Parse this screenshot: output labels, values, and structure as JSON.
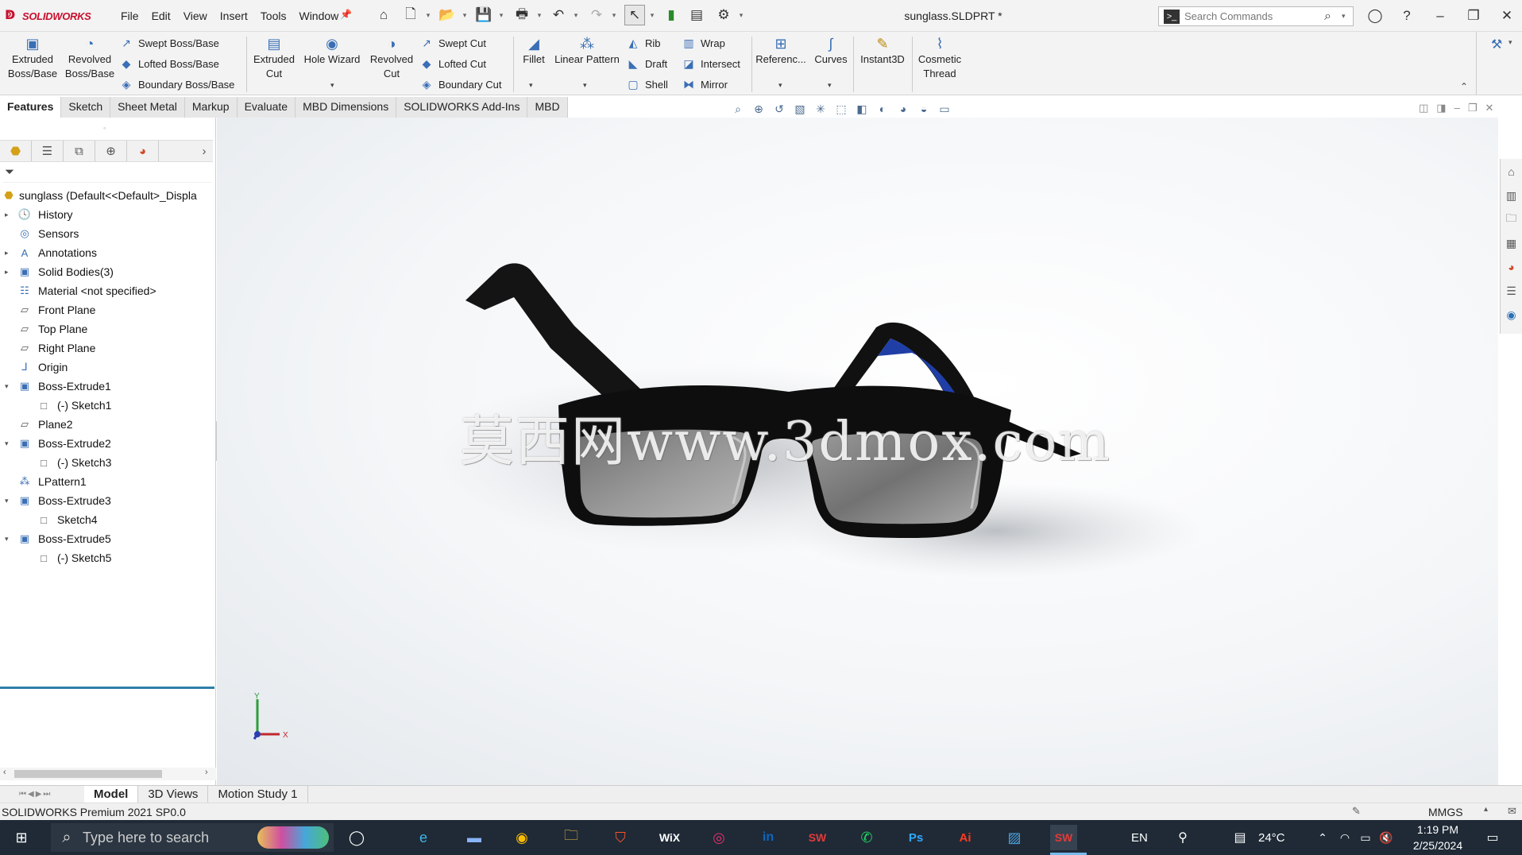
{
  "app": {
    "logo_text": "SOLIDWORKS",
    "menu": [
      "File",
      "Edit",
      "View",
      "Insert",
      "Tools",
      "Window"
    ],
    "document_title": "sunglass.SLDPRT *",
    "search_placeholder": "Search Commands"
  },
  "command_manager": {
    "big_buttons": [
      {
        "label": "Extruded\nBoss/Base",
        "icon": "extruded-boss-icon"
      },
      {
        "label": "Revolved\nBoss/Base",
        "icon": "revolved-boss-icon"
      },
      {
        "label": "Extruded\nCut",
        "icon": "extruded-cut-icon"
      },
      {
        "label": "Hole Wizard",
        "icon": "hole-wizard-icon"
      },
      {
        "label": "Revolved\nCut",
        "icon": "revolved-cut-icon"
      },
      {
        "label": "Fillet",
        "icon": "fillet-icon"
      },
      {
        "label": "Linear Pattern",
        "icon": "linear-pattern-icon"
      },
      {
        "label": "Referenc...",
        "icon": "reference-geometry-icon"
      },
      {
        "label": "Curves",
        "icon": "curves-icon"
      },
      {
        "label": "Instant3D",
        "icon": "instant3d-icon"
      },
      {
        "label": "Cosmetic\nThread",
        "icon": "cosmetic-thread-icon"
      }
    ],
    "small_buttons": [
      {
        "label": "Swept Boss/Base",
        "icon": "swept-boss-icon"
      },
      {
        "label": "Lofted Boss/Base",
        "icon": "lofted-boss-icon"
      },
      {
        "label": "Boundary Boss/Base",
        "icon": "boundary-boss-icon"
      },
      {
        "label": "Swept Cut",
        "icon": "swept-cut-icon"
      },
      {
        "label": "Lofted Cut",
        "icon": "lofted-cut-icon"
      },
      {
        "label": "Boundary Cut",
        "icon": "boundary-cut-icon"
      },
      {
        "label": "Rib",
        "icon": "rib-icon"
      },
      {
        "label": "Draft",
        "icon": "draft-icon"
      },
      {
        "label": "Shell",
        "icon": "shell-icon"
      },
      {
        "label": "Wrap",
        "icon": "wrap-icon"
      },
      {
        "label": "Intersect",
        "icon": "intersect-icon"
      },
      {
        "label": "Mirror",
        "icon": "mirror-icon"
      }
    ]
  },
  "tabs": [
    "Features",
    "Sketch",
    "Sheet Metal",
    "Markup",
    "Evaluate",
    "MBD Dimensions",
    "SOLIDWORKS Add-Ins",
    "MBD"
  ],
  "active_tab": "Features",
  "feature_tree": {
    "root": "sunglass  (Default<<Default>_Displa",
    "nodes": [
      {
        "label": "History",
        "icon": "history-icon",
        "expander": "right"
      },
      {
        "label": "Sensors",
        "icon": "sensors-icon",
        "expander": ""
      },
      {
        "label": "Annotations",
        "icon": "annotations-icon",
        "expander": "right"
      },
      {
        "label": "Solid Bodies(3)",
        "icon": "solid-bodies-icon",
        "expander": "right"
      },
      {
        "label": "Material <not specified>",
        "icon": "material-icon",
        "expander": ""
      },
      {
        "label": "Front Plane",
        "icon": "plane-icon",
        "expander": ""
      },
      {
        "label": "Top Plane",
        "icon": "plane-icon",
        "expander": ""
      },
      {
        "label": "Right Plane",
        "icon": "plane-icon",
        "expander": ""
      },
      {
        "label": "Origin",
        "icon": "origin-icon",
        "expander": ""
      },
      {
        "label": "Boss-Extrude1",
        "icon": "boss-extrude-icon",
        "expander": "down"
      },
      {
        "label": "(-) Sketch1",
        "icon": "sketch-icon",
        "expander": "",
        "child": true
      },
      {
        "label": "Plane2",
        "icon": "plane-icon",
        "expander": ""
      },
      {
        "label": "Boss-Extrude2",
        "icon": "boss-extrude-icon",
        "expander": "down"
      },
      {
        "label": "(-) Sketch3",
        "icon": "sketch-icon",
        "expander": "",
        "child": true
      },
      {
        "label": "LPattern1",
        "icon": "linear-pattern-icon",
        "expander": ""
      },
      {
        "label": "Boss-Extrude3",
        "icon": "boss-extrude-icon",
        "expander": "down"
      },
      {
        "label": "Sketch4",
        "icon": "sketch-icon",
        "expander": "",
        "child": true
      },
      {
        "label": "Boss-Extrude5",
        "icon": "boss-extrude-icon",
        "expander": "down"
      },
      {
        "label": "(-) Sketch5",
        "icon": "sketch-icon",
        "expander": "",
        "child": true
      }
    ]
  },
  "viewport": {
    "watermark": "莫西网www.3dmox.com",
    "triad_x": "X",
    "triad_y": "Y",
    "colors": {
      "frame": "#111111",
      "lens": "#8c8c8c",
      "accent": "#1f3fa6"
    }
  },
  "bottom_tabs": [
    "Model",
    "3D Views",
    "Motion Study 1"
  ],
  "active_bottom_tab": "Model",
  "status": {
    "version": "SOLIDWORKS Premium 2021 SP0.0",
    "units": "MMGS"
  },
  "taskbar": {
    "search_placeholder": "Type here to search",
    "language": "EN",
    "temperature": "24°C",
    "time": "1:19 PM",
    "date": "2/25/2024"
  }
}
